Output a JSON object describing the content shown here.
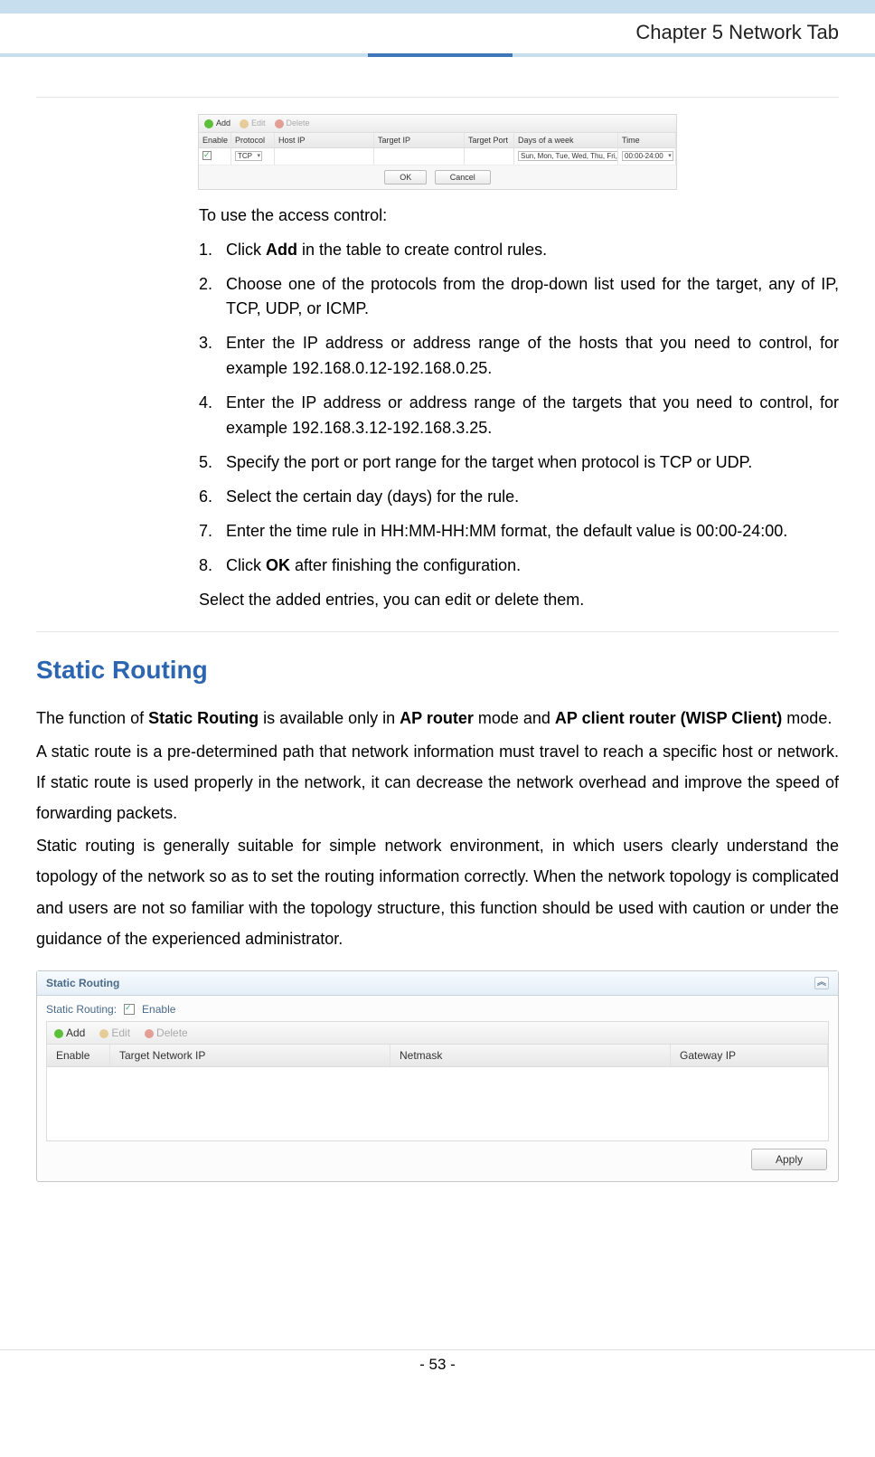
{
  "chapter": {
    "title": "Chapter 5 Network Tab"
  },
  "figure1": {
    "toolbar": {
      "add": "Add",
      "edit": "Edit",
      "delete": "Delete"
    },
    "headers": {
      "enable": "Enable",
      "protocol": "Protocol",
      "host_ip": "Host IP",
      "target_ip": "Target IP",
      "target_port": "Target Port",
      "days": "Days of a week",
      "time": "Time"
    },
    "row": {
      "protocol": "TCP",
      "days": "Sun, Mon, Tue, Wed, Thu, Fri, Sat",
      "time": "00:00-24:00"
    },
    "actions": {
      "ok": "OK",
      "cancel": "Cancel"
    }
  },
  "access_control": {
    "intro": "To use the access control:",
    "steps": {
      "s1_num": "1.",
      "s1_a": "Click ",
      "s1_b": "Add",
      "s1_c": " in the table to create control rules.",
      "s2_num": "2.",
      "s2": "Choose one of the protocols from the drop-down list used for the target, any of IP, TCP, UDP, or ICMP.",
      "s3_num": "3.",
      "s3": "Enter the IP address or address range of the hosts that you need to control, for example 192.168.0.12-192.168.0.25.",
      "s4_num": "4.",
      "s4": "Enter the IP address or address range of the targets that you need to control, for example 192.168.3.12-192.168.3.25.",
      "s5_num": "5.",
      "s5": "Specify the port or port range for the target when protocol is TCP or UDP.",
      "s6_num": "6.",
      "s6": "Select the certain day (days) for the rule.",
      "s7_num": "7.",
      "s7": "Enter the time rule in HH:MM-HH:MM format, the default value is 00:00-24:00.",
      "s8_num": "8.",
      "s8_a": "Click ",
      "s8_b": "OK",
      "s8_c": " after finishing the configuration."
    },
    "post": "Select the added entries, you can edit or delete them."
  },
  "static_routing": {
    "heading": "Static Routing",
    "p1_a": "The function of ",
    "p1_b": "Static Routing",
    "p1_c": " is available only in ",
    "p1_d": "AP router",
    "p1_e": " mode and ",
    "p1_f": "AP client router (WISP Client)",
    "p1_g": " mode.",
    "p2": "A static route is a pre-determined path that network information must travel to reach a specific host or network. If static route is used properly in the network, it can decrease the network overhead and improve the speed of forwarding packets.",
    "p3": "Static routing is generally suitable for simple network environment, in which users clearly understand the topology of the network so as to set the routing information correctly.  When the network topology is complicated and users are not so familiar with the topology structure, this function should be used with caution or under the guidance of the experienced administrator."
  },
  "figure2": {
    "panel_title": "Static Routing",
    "enable_label": "Static Routing:",
    "enable_check": "Enable",
    "toolbar": {
      "add": "Add",
      "edit": "Edit",
      "delete": "Delete"
    },
    "headers": {
      "enable": "Enable",
      "target_ip": "Target Network IP",
      "netmask": "Netmask",
      "gateway": "Gateway IP"
    },
    "apply": "Apply"
  },
  "footer": {
    "page": "- 53 -"
  }
}
